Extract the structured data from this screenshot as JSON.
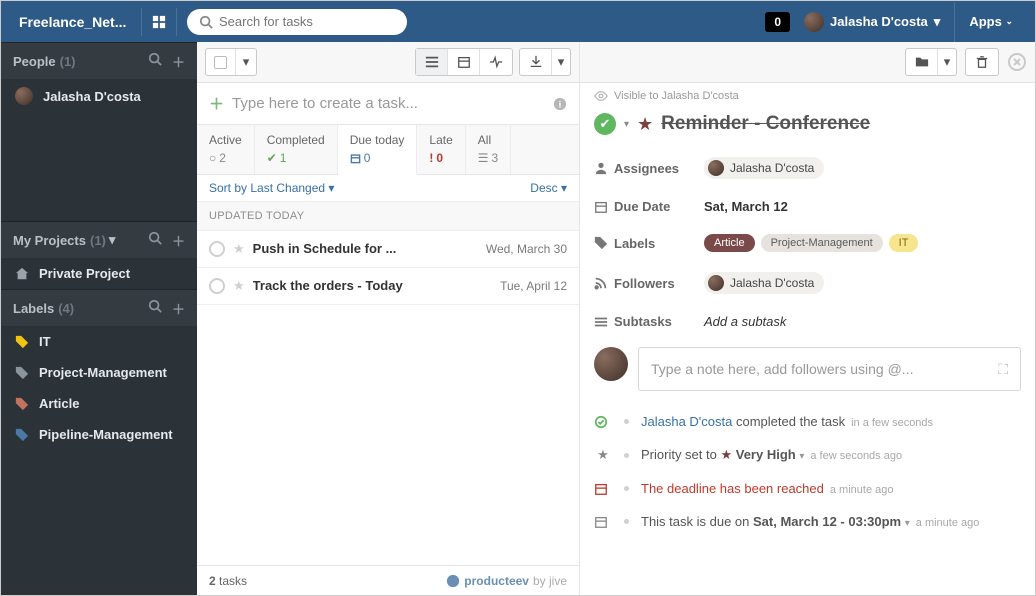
{
  "topbar": {
    "brand": "Freelance_Net...",
    "search_placeholder": "Search for tasks",
    "badge": "0",
    "user": "Jalasha D'costa",
    "apps": "Apps"
  },
  "sidebar": {
    "people": {
      "title": "People",
      "count": "(1)",
      "items": [
        "Jalasha D'costa"
      ]
    },
    "projects": {
      "title": "My Projects",
      "count": "(1)",
      "items": [
        "Private Project"
      ]
    },
    "labels": {
      "title": "Labels",
      "count": "(4)",
      "items": [
        "IT",
        "Project-Management",
        "Article",
        "Pipeline-Management"
      ]
    }
  },
  "center": {
    "new_task_placeholder": "Type here to create a task...",
    "filters": {
      "active": {
        "label": "Active",
        "value": "2"
      },
      "completed": {
        "label": "Completed",
        "value": "1"
      },
      "duetoday": {
        "label": "Due today",
        "value": "0"
      },
      "late": {
        "label": "Late",
        "value": "0"
      },
      "all": {
        "label": "All",
        "value": "3"
      }
    },
    "sort_by": "Sort by Last Changed",
    "sort_dir": "Desc",
    "group": "UPDATED TODAY",
    "tasks": [
      {
        "title": "Push in Schedule for ...",
        "date": "Wed, March 30"
      },
      {
        "title": "Track the orders - Today",
        "date": "Tue, April 12"
      }
    ],
    "footer_count": "2",
    "footer_label": "tasks",
    "brand1": "producteev",
    "brand2": "by jive"
  },
  "detail": {
    "visible": "Visible to Jalasha D'costa",
    "title": "Reminder - Conference",
    "assignees_label": "Assignees",
    "assignee": "Jalasha D'costa",
    "duedate_label": "Due Date",
    "duedate": "Sat, March 12",
    "labels_label": "Labels",
    "tags": {
      "article": "Article",
      "pm": "Project-Management",
      "it": "IT"
    },
    "followers_label": "Followers",
    "follower": "Jalasha D'costa",
    "subtasks_label": "Subtasks",
    "addsub": "Add a subtask",
    "note_placeholder": "Type a note here, add followers using @...",
    "activity": {
      "a1_user": "Jalasha D'costa",
      "a1_text": " completed the task",
      "a1_time": "in a few seconds",
      "a2_text": "Priority set to ",
      "a2_level": " Very High",
      "a2_time": "a few seconds ago",
      "a3_text": "The deadline has been reached",
      "a3_time": "a minute ago",
      "a4_pre": "This task is due on ",
      "a4_date": "Sat, March 12 - 03:30pm",
      "a4_time": "a minute ago"
    }
  }
}
